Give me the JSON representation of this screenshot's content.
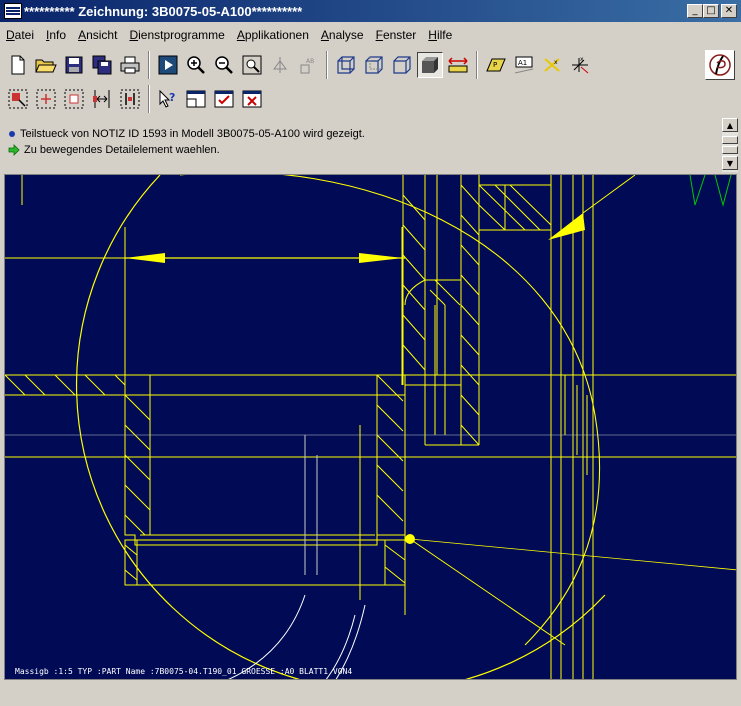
{
  "window": {
    "title": "********** Zeichnung: 3B0075-05-A100**********"
  },
  "menu": {
    "items": [
      {
        "id": "datei",
        "label": "Datei",
        "mnemonic": "D",
        "rest": "atei"
      },
      {
        "id": "info",
        "label": "Info",
        "mnemonic": "I",
        "rest": "nfo"
      },
      {
        "id": "ansicht",
        "label": "Ansicht",
        "mnemonic": "A",
        "rest": "nsicht"
      },
      {
        "id": "dienstprogramme",
        "label": "Dienstprogramme",
        "mnemonic": "D",
        "rest": "ienstprogramme"
      },
      {
        "id": "applikationen",
        "label": "Applikationen",
        "mnemonic": "A",
        "rest": "pplikationen"
      },
      {
        "id": "analyse",
        "label": "Analyse",
        "mnemonic": "A",
        "rest": "nalyse"
      },
      {
        "id": "fenster",
        "label": "Fenster",
        "mnemonic": "F",
        "rest": "enster"
      },
      {
        "id": "hilfe",
        "label": "Hilfe",
        "mnemonic": "H",
        "rest": "ilfe"
      }
    ]
  },
  "messages": {
    "line1": "Teilstueck von NOTIZ ID 1593 in Modell 3B0075-05-A100 wird gezeigt.",
    "line2": "Zu bewegendes Detailelement waehlen."
  },
  "drawing": {
    "footer_text": "Massigb :1:5     TYP :PART   Name :7B0075-04.T190_01   GROESSE :A0   BLATT1 VON4"
  },
  "icons": {
    "toolbar1": [
      "new-file-icon",
      "open-folder-icon",
      "save-icon",
      "save-copy-icon",
      "print-icon",
      "repaint-icon",
      "zoom-in-icon",
      "zoom-out-icon",
      "zoom-fit-icon",
      "spin-icon",
      "view-list-icon",
      "wireframe-icon",
      "hidden-line-icon",
      "no-hidden-icon",
      "shaded-icon",
      "dimension-icon",
      "datum-planes-icon",
      "datum-axes-icon",
      "datum-points-icon",
      "coordinate-systems-icon"
    ],
    "toolbar2": [
      "select-region-icon",
      "detail-view-icon",
      "detail-move-icon",
      "detail-align-icon",
      "detail-snap-icon",
      "context-help-icon",
      "window-tile-icon",
      "window-activate-icon",
      "window-close-icon"
    ]
  },
  "colors": {
    "canvas": "#000a55",
    "line": "#ffff00",
    "titlebar": "#0a246a"
  }
}
